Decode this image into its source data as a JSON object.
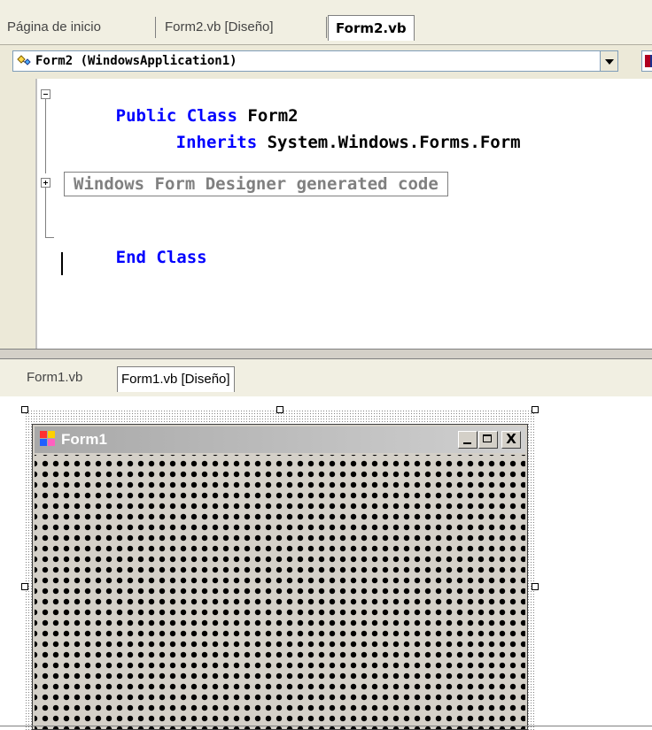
{
  "top_tabs": [
    {
      "label": "Página de inicio"
    },
    {
      "label": "Form2.vb [Diseño]"
    },
    {
      "label": "Form2.vb",
      "active": true
    }
  ],
  "class_dropdown": {
    "selected": "Form2 (WindowsApplication1)",
    "icon": "class-icon"
  },
  "code": {
    "line1_kw": "Public Class",
    "line1_name": "Form2",
    "line2_kw": "Inherits",
    "line2_text": "System.Windows.Forms.Form",
    "region_label": "Windows Form Designer generated code",
    "line_end": "End Class"
  },
  "bottom_tabs": [
    {
      "label": "Form1.vb"
    },
    {
      "label": "Form1.vb [Diseño]",
      "active": true
    }
  ],
  "designer": {
    "form_title": "Form1",
    "close_glyph": "X"
  },
  "colors": {
    "keyword": "#0000ff",
    "region_text": "#808080",
    "form_background": "#d4d0c8"
  }
}
